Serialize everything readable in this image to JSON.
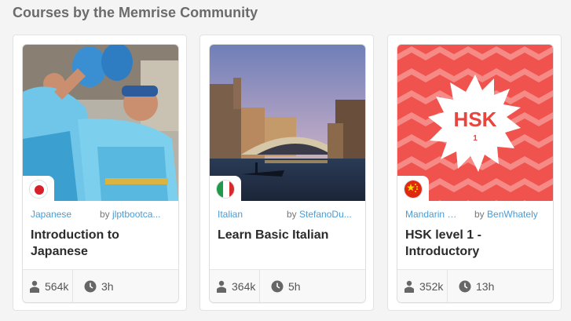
{
  "section": {
    "title": "Courses by the Memrise Community"
  },
  "courses": [
    {
      "image": "japanese-festival-dancers",
      "flag": "japan-flag",
      "language": "Japanese",
      "by": "by",
      "author": "jlptbootca...",
      "title": "Introduction to Japanese",
      "learners": "564k",
      "duration": "3h"
    },
    {
      "image": "venice-rialto-bridge",
      "flag": "italy-flag",
      "language": "Italian",
      "by": "by",
      "author": "StefanoDu...",
      "title": "Learn Basic Italian",
      "learners": "364k",
      "duration": "5h"
    },
    {
      "image": "hsk-badge-zigzag",
      "image_text": "HSK",
      "image_subtext": "1",
      "flag": "china-flag",
      "language": "Mandarin Ch...",
      "by": "by",
      "author": "BenWhately",
      "title": "HSK level 1 - Introductory",
      "learners": "352k",
      "duration": "13h"
    }
  ],
  "colors": {
    "link": "#4a9bd5",
    "hsk_red": "#f0534d"
  }
}
